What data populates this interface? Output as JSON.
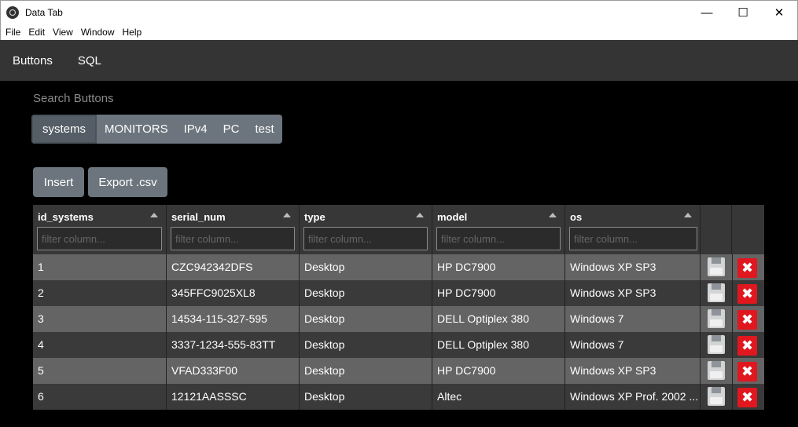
{
  "window": {
    "title": "Data Tab",
    "minimize": "—",
    "maximize": "☐",
    "close": "✕"
  },
  "menu": [
    "File",
    "Edit",
    "View",
    "Window",
    "Help"
  ],
  "nav": [
    "Buttons",
    "SQL"
  ],
  "search_label": "Search Buttons",
  "button_group": {
    "active": "systems",
    "items": [
      "systems",
      "MONITORS",
      "IPv4",
      "PC",
      "test"
    ]
  },
  "actions": {
    "insert": "Insert",
    "export": "Export .csv"
  },
  "table": {
    "columns": [
      "id_systems",
      "serial_num",
      "type",
      "model",
      "os"
    ],
    "filter_placeholder": "filter column...",
    "rows": [
      [
        "1",
        "CZC942342DFS",
        "Desktop",
        "HP DC7900",
        "Windows XP SP3"
      ],
      [
        "2",
        "345FFC9025XL8",
        "Desktop",
        "HP DC7900",
        "Windows XP SP3"
      ],
      [
        "3",
        "14534-115-327-595",
        "Desktop",
        "DELL Optiplex 380",
        "Windows 7"
      ],
      [
        "4",
        "3337-1234-555-83TT",
        "Desktop",
        "DELL Optiplex 380",
        "Windows 7"
      ],
      [
        "5",
        "VFAD333F00",
        "Desktop",
        "HP DC7900",
        "Windows XP SP3"
      ],
      [
        "6",
        "12121AASSSC",
        "Desktop",
        "Altec",
        "Windows XP Prof. 2002 ..."
      ]
    ],
    "row_icons": {
      "save": "save-icon",
      "delete": "delete-icon",
      "delete_glyph": "✖"
    }
  },
  "colors": {
    "accent_button": "#6c757d",
    "delete": "#e0171e",
    "nav_bg": "#343434"
  }
}
